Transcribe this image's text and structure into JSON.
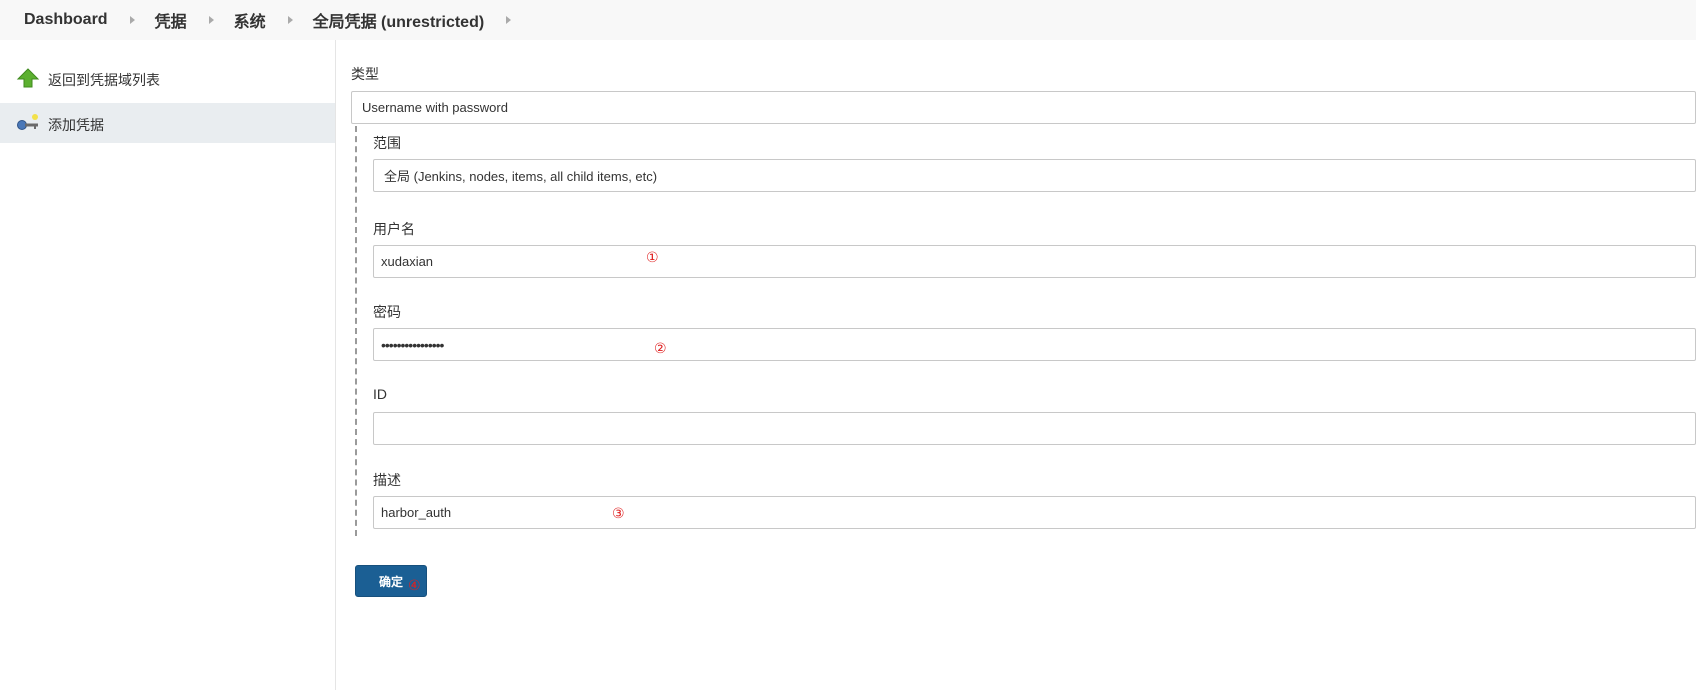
{
  "breadcrumb": {
    "items": [
      "Dashboard",
      "凭据",
      "系统",
      "全局凭据 (unrestricted)"
    ]
  },
  "sidebar": {
    "items": [
      {
        "label": "返回到凭据域列表",
        "icon": "green-up-arrow-icon"
      },
      {
        "label": "添加凭据",
        "icon": "key-icon",
        "active": true
      }
    ]
  },
  "form": {
    "kind_label": "类型",
    "kind_value": "Username with password",
    "scope_label": "范围",
    "scope_value": "全局 (Jenkins, nodes, items, all child items, etc)",
    "username_label": "用户名",
    "username_value": "xudaxian",
    "password_label": "密码",
    "password_value": "••••••••••••••••",
    "id_label": "ID",
    "id_value": "",
    "description_label": "描述",
    "description_value": "harbor_auth",
    "submit_label": "确定"
  },
  "annotations": {
    "username_mark": "①",
    "password_mark": "②",
    "description_mark": "③",
    "submit_mark": "④"
  },
  "colors": {
    "annotation": "#e02020",
    "submit_button": "#1b5f94",
    "active_sidebar": "#e9edf0"
  }
}
